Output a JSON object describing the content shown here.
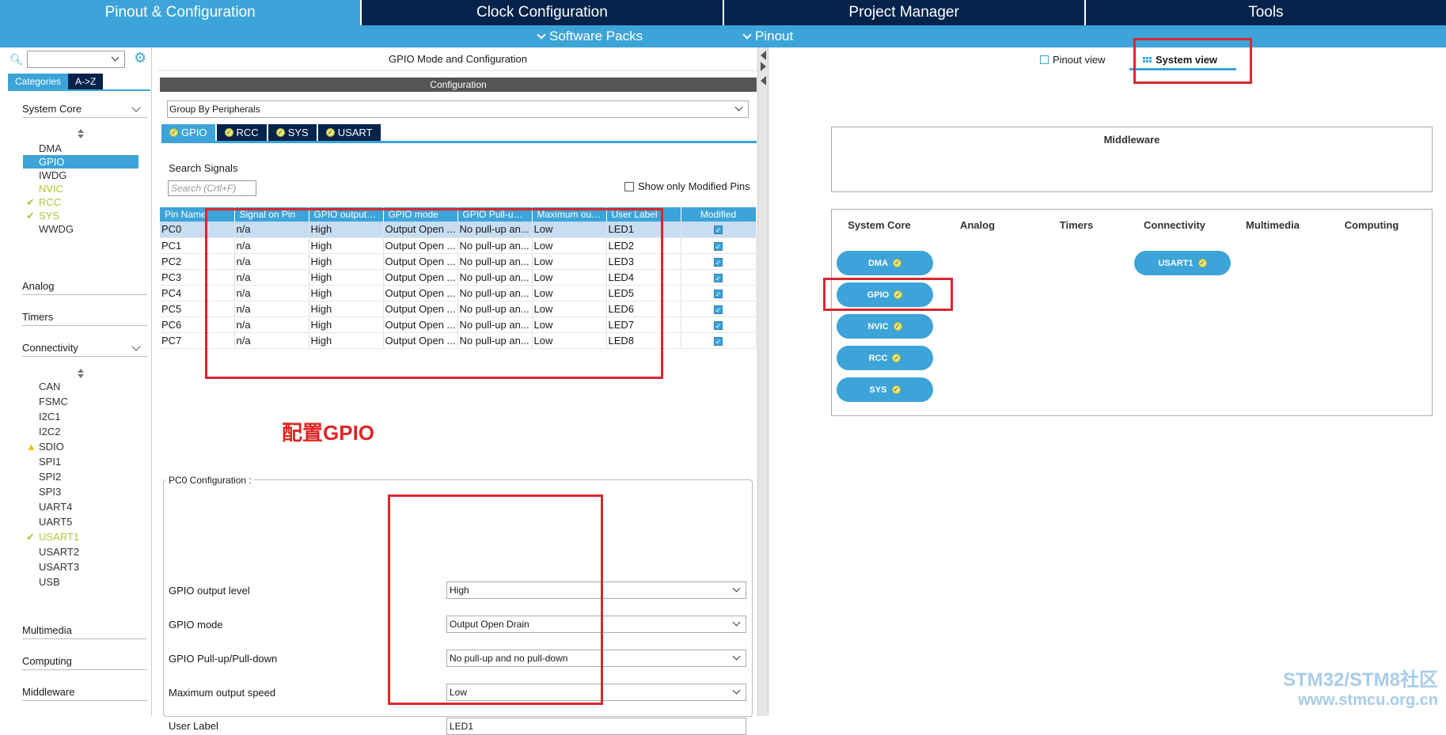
{
  "topnav": {
    "tabs": [
      "Pinout & Configuration",
      "Clock Configuration",
      "Project Manager",
      "Tools"
    ]
  },
  "subnav": {
    "software_packs": "Software Packs",
    "pinout": "Pinout"
  },
  "sidebar": {
    "tab_categories": "Categories",
    "tab_az": "A->Z",
    "groups": {
      "system_core": "System Core",
      "analog": "Analog",
      "timers": "Timers",
      "connectivity": "Connectivity",
      "multimedia": "Multimedia",
      "computing": "Computing",
      "middleware": "Middleware"
    },
    "system_core_items": [
      "DMA",
      "GPIO",
      "IWDG",
      "NVIC",
      "RCC",
      "SYS",
      "WWDG"
    ],
    "connectivity_items": [
      "CAN",
      "FSMC",
      "I2C1",
      "I2C2",
      "SDIO",
      "SPI1",
      "SPI2",
      "SPI3",
      "UART4",
      "UART5",
      "USART1",
      "USART2",
      "USART3",
      "USB"
    ]
  },
  "center": {
    "title": "GPIO Mode and Configuration",
    "config_bar": "Configuration",
    "group_by": "Group By Peripherals",
    "peripheral_tabs": [
      "GPIO",
      "RCC",
      "SYS",
      "USART"
    ],
    "search_label": "Search Signals",
    "search_placeholder": "Search (Crtl+F)",
    "show_modified": "Show only Modified Pins",
    "table": {
      "headers": [
        "Pin Name",
        "Signal on Pin",
        "GPIO output l...",
        "GPIO mode",
        "GPIO Pull-up/...",
        "Maximum out...",
        "User Label",
        "Modified"
      ],
      "rows": [
        [
          "PC0",
          "n/a",
          "High",
          "Output Open ...",
          "No pull-up an...",
          "Low",
          "LED1"
        ],
        [
          "PC1",
          "n/a",
          "High",
          "Output Open ...",
          "No pull-up an...",
          "Low",
          "LED2"
        ],
        [
          "PC2",
          "n/a",
          "High",
          "Output Open ...",
          "No pull-up an...",
          "Low",
          "LED3"
        ],
        [
          "PC3",
          "n/a",
          "High",
          "Output Open ...",
          "No pull-up an...",
          "Low",
          "LED4"
        ],
        [
          "PC4",
          "n/a",
          "High",
          "Output Open ...",
          "No pull-up an...",
          "Low",
          "LED5"
        ],
        [
          "PC5",
          "n/a",
          "High",
          "Output Open ...",
          "No pull-up an...",
          "Low",
          "LED6"
        ],
        [
          "PC6",
          "n/a",
          "High",
          "Output Open ...",
          "No pull-up an...",
          "Low",
          "LED7"
        ],
        [
          "PC7",
          "n/a",
          "High",
          "Output Open ...",
          "No pull-up an...",
          "Low",
          "LED8"
        ]
      ]
    },
    "annotation": "配置GPIO",
    "pc0_legend": "PC0 Configuration :",
    "pc0_fields": [
      {
        "label": "GPIO output level",
        "value": "High"
      },
      {
        "label": "GPIO mode",
        "value": "Output Open Drain"
      },
      {
        "label": "GPIO Pull-up/Pull-down",
        "value": "No pull-up and no pull-down"
      },
      {
        "label": "Maximum output speed",
        "value": "Low"
      },
      {
        "label": "User Label",
        "value": "LED1"
      }
    ]
  },
  "right": {
    "pinout_view": "Pinout view",
    "system_view": "System view",
    "middleware": "Middleware",
    "categories": [
      "System Core",
      "Analog",
      "Timers",
      "Connectivity",
      "Multimedia",
      "Computing"
    ],
    "system_core_pills": [
      "DMA",
      "GPIO",
      "NVIC",
      "RCC",
      "SYS"
    ],
    "connectivity_pills": [
      "USART1"
    ]
  },
  "watermark": {
    "line1": "STM32/STM8社区",
    "line2": "www.stmcu.org.cn"
  },
  "colors": {
    "navy": "#03234b",
    "accent": "#3ca4d8",
    "annotation": "#d9272e"
  }
}
